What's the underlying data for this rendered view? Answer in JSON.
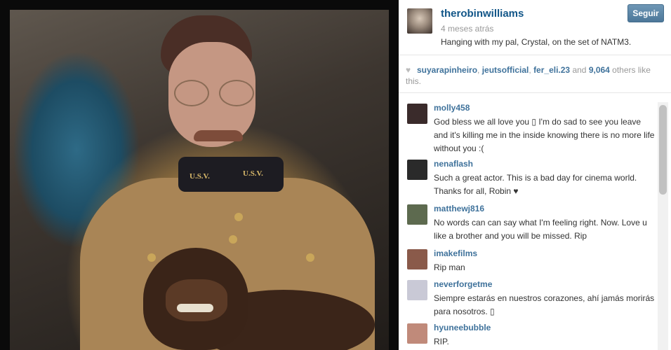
{
  "post": {
    "author": "therobinwilliams",
    "time_ago": "4 meses atrás",
    "caption": "Hanging with my pal, Crystal, on the set of NATM3.",
    "follow_label": "Seguir",
    "photo": {
      "collar_text_left": "U.S.V.",
      "collar_text_right": "U.S.V."
    }
  },
  "likes": {
    "icon": "heart-icon",
    "user1": "suyarapinheiro",
    "sep1": ", ",
    "user2": "jeutsofficial",
    "sep2": ", ",
    "user3": "fer_eli.23",
    "and_text": " and ",
    "count": "9,064",
    "suffix": " others like this."
  },
  "comments": [
    {
      "user": "molly458",
      "text": "God bless we all love you ▯ I'm do sad to see you leave and it's killing me in the inside knowing there is no more life without you :(",
      "avatar_color": "#3a2b2b"
    },
    {
      "user": "nenaflash",
      "text": "Such a great actor. This is a bad day for cinema world. Thanks for all, Robin ♥",
      "avatar_color": "#2a2a2a"
    },
    {
      "user": "matthewj816",
      "text": "No words can can say what I'm feeling right. Now. Love u like a brother and you will be missed. Rip",
      "avatar_color": "#5d6a4f"
    },
    {
      "user": "imakefilms",
      "text": "Rip man",
      "avatar_color": "#8a5a4a"
    },
    {
      "user": "neverforgetme",
      "text": "Siempre estarás en nuestros corazones, ahí jamás morirás para nosotros. ▯",
      "avatar_color": "#c9c9d6"
    },
    {
      "user": "hyuneebubble",
      "text": "RIP.",
      "avatar_color": "#c08a7a"
    }
  ]
}
